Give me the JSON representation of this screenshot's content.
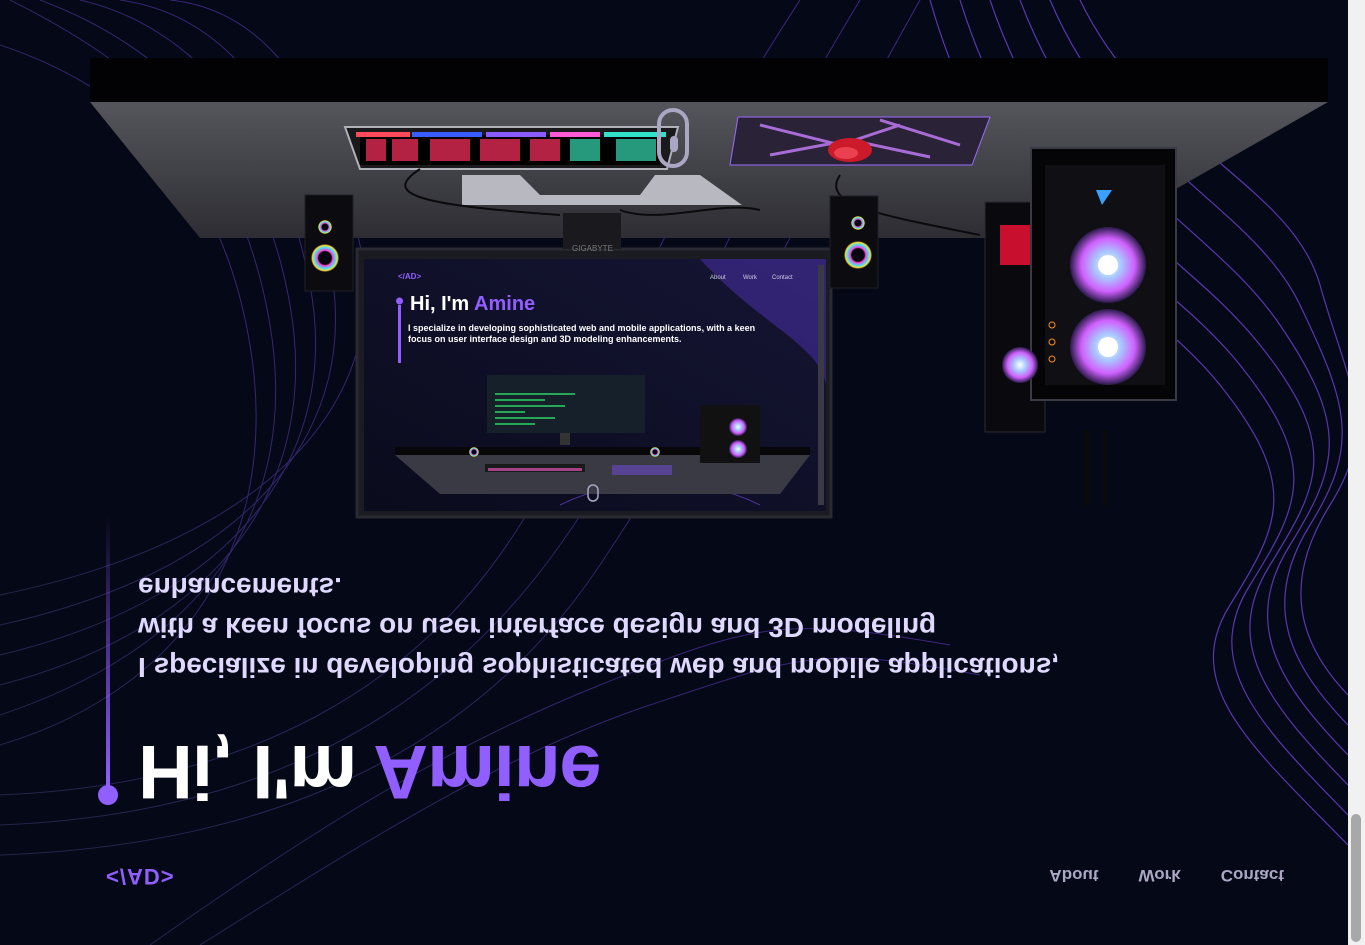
{
  "brand": {
    "logo_text": "</AD>",
    "accent": "#915eff",
    "background": "#050816"
  },
  "nav": {
    "items": [
      {
        "label": "About"
      },
      {
        "label": "Work"
      },
      {
        "label": "Contact"
      }
    ]
  },
  "hero": {
    "title_prefix": "Hi, I'm ",
    "title_name": "Amine",
    "subtitle_line1": "I specialize in developing sophisticated web and mobile applications,",
    "subtitle_line2": "with a keen focus on user interface design and 3D modeling",
    "subtitle_line3": "enhancements."
  },
  "monitor": {
    "brand_label": "GIGABYTE",
    "screen": {
      "logo_text": "</AD>",
      "nav": [
        "About",
        "Work",
        "Contact"
      ],
      "title_prefix": "Hi, I'm ",
      "title_name": "Amine",
      "subtitle": "I specialize in developing sophisticated web and mobile applications, with a keen focus on user interface design and 3D modeling enhancements."
    }
  },
  "scroll_indicator": {
    "icon": "mouse-scroll-icon"
  },
  "icons": {
    "logo": "logo-text",
    "speaker": "speaker-icon",
    "pc_case": "pc-case-icon",
    "keyboard": "keyboard-icon",
    "mousepad": "mousepad-icon"
  }
}
